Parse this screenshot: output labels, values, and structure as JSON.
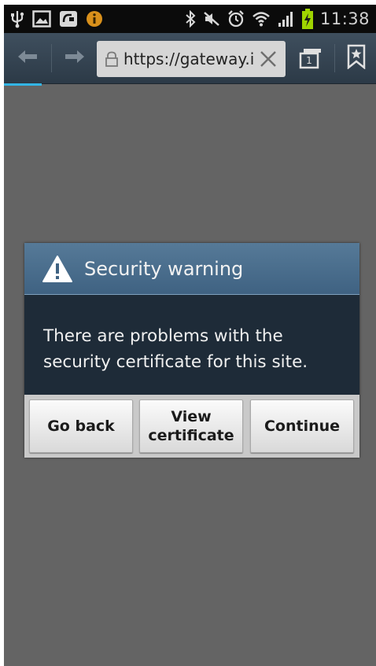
{
  "status_bar": {
    "time": "11:38",
    "left_icons": [
      "usb-icon",
      "image-icon",
      "voicemail-icon",
      "info-icon"
    ],
    "right_icons": [
      "bluetooth-icon",
      "mute-icon",
      "alarm-icon",
      "wifi-icon",
      "signal-icon",
      "battery-charging-icon"
    ],
    "battery_color": "#9fd400"
  },
  "toolbar": {
    "url": "https://gateway.i",
    "tab_count": "1",
    "back_icon": "arrow-left-icon",
    "forward_icon": "arrow-right-icon",
    "lock_icon": "lock-icon",
    "clear_icon": "close-icon",
    "tabs_icon": "tabs-icon",
    "bookmark_icon": "bookmark-icon"
  },
  "dialog": {
    "title": "Security warning",
    "warning_icon": "warning-icon",
    "message_line1": "There are problems with the",
    "message_line2": "security certificate for this site.",
    "buttons": {
      "go_back": "Go back",
      "view_certificate_line1": "View",
      "view_certificate_line2": "certificate",
      "continue": "Continue"
    }
  },
  "colors": {
    "accent_progress": "#33b5e5",
    "dialog_header": "#4a6e8e",
    "dialog_body": "#1e2b38",
    "page_background": "#646464"
  }
}
